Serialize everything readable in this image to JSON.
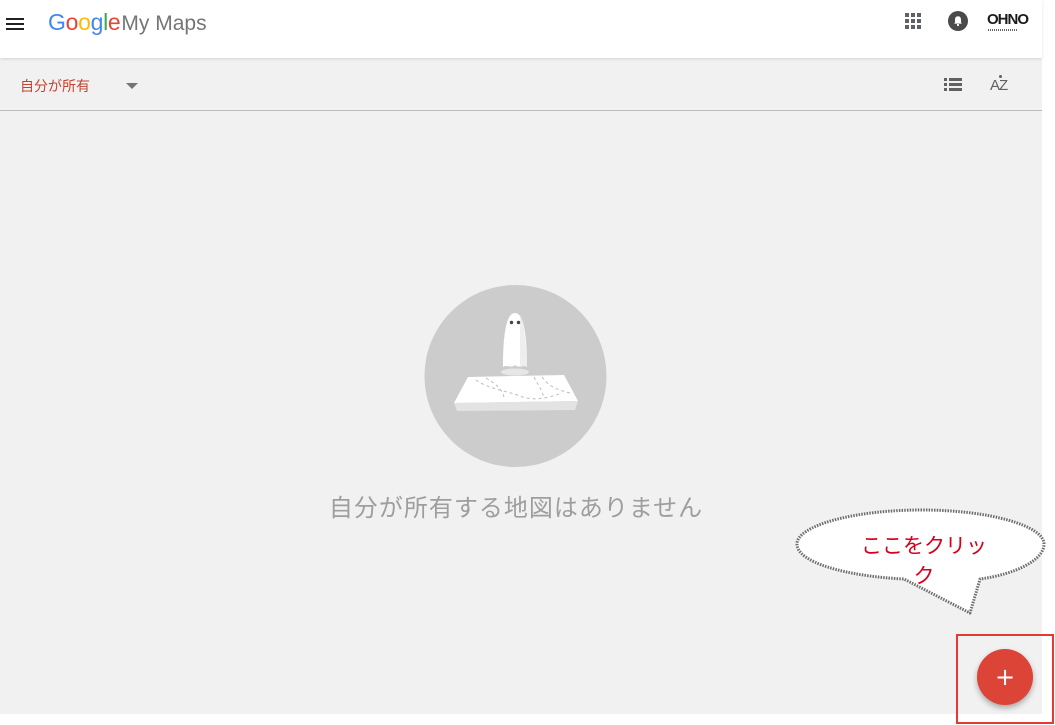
{
  "header": {
    "brand_google_letters": [
      "G",
      "o",
      "o",
      "g",
      "l",
      "e"
    ],
    "brand_product": "My Maps",
    "account_logo_text": "OHNO",
    "icons": {
      "menu": "hamburger-menu-icon",
      "apps": "apps-grid-icon",
      "notifications": "notification-bell-icon",
      "account": "account-logo-icon"
    }
  },
  "filter_bar": {
    "owner_filter_label": "自分が所有",
    "sort_label": "AZ",
    "icons": {
      "owner_caret": "caret-down-icon",
      "list_view": "list-view-icon",
      "sort": "sort-az-icon"
    }
  },
  "main": {
    "empty_message": "自分が所有する地図はありません",
    "empty_illustration": "ghost-on-map-illustration"
  },
  "annotation": {
    "callout_text": "ここをクリック"
  },
  "fab": {
    "label": "+",
    "icon": "plus-icon"
  },
  "colors": {
    "accent_red": "#db4437",
    "filter_label": "#c5432f",
    "callout_text": "#d6001c",
    "highlight_border": "#e53935",
    "background_gray": "#f1f1f1",
    "empty_text": "#9e9e9e"
  }
}
